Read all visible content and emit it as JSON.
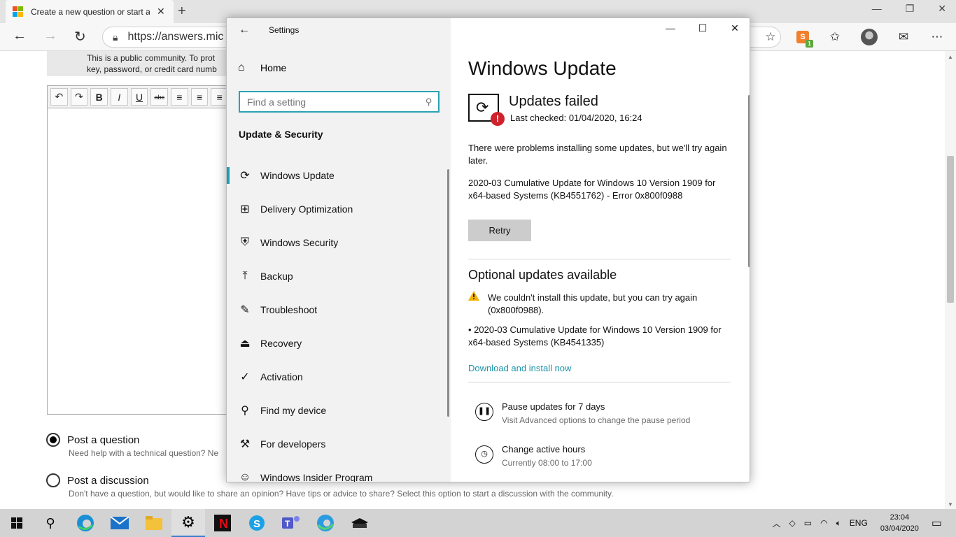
{
  "browser": {
    "tab_title": "Create a new question or start a",
    "tab_close": "✕",
    "new_tab": "+",
    "url": "https://answers.mic",
    "favicon_colors": [
      "#f25022",
      "#7fba00",
      "#00a4ef",
      "#ffb900"
    ],
    "ext_badge": "S"
  },
  "page": {
    "notice_line1": "This is a public community. To prot",
    "notice_line2": "key, password, or credit card numb",
    "toolbar": [
      "↶",
      "↷",
      "B",
      "I",
      "U",
      "abc",
      "≡",
      "≡",
      "≡"
    ],
    "post_question": {
      "label": "Post a question",
      "desc": "Need help with a technical question? Ne",
      "checked": true
    },
    "post_discussion": {
      "label": "Post a discussion",
      "desc": "Don't have a question, but would like to share an opinion? Have tips or advice to share? Select this option to start a discussion with the community.",
      "checked": false
    }
  },
  "settings": {
    "app_title": "Settings",
    "home": "Home",
    "search_placeholder": "Find a setting",
    "section": "Update & Security",
    "nav": [
      {
        "label": "Windows Update",
        "icon": "sync-icon",
        "glyph": "⟳"
      },
      {
        "label": "Delivery Optimization",
        "icon": "delivery-icon",
        "glyph": "⊞"
      },
      {
        "label": "Windows Security",
        "icon": "shield-icon",
        "glyph": "⛨"
      },
      {
        "label": "Backup",
        "icon": "backup-icon",
        "glyph": "⤒"
      },
      {
        "label": "Troubleshoot",
        "icon": "wrench-icon",
        "glyph": "✎"
      },
      {
        "label": "Recovery",
        "icon": "recovery-icon",
        "glyph": "⏏"
      },
      {
        "label": "Activation",
        "icon": "check-circle-icon",
        "glyph": "✓"
      },
      {
        "label": "Find my device",
        "icon": "person-icon",
        "glyph": "⚲"
      },
      {
        "label": "For developers",
        "icon": "developer-icon",
        "glyph": "⚒"
      },
      {
        "label": "Windows Insider Program",
        "icon": "insider-icon",
        "glyph": "☺"
      }
    ],
    "main": {
      "title": "Windows Update",
      "status": "Updates failed",
      "last_checked": "Last checked: 01/04/2020, 16:24",
      "problem_text": "There were problems installing some updates, but we'll try again later.",
      "error_text": "2020-03 Cumulative Update for Windows 10 Version 1909 for x64-based Systems (KB4551762) - Error 0x800f0988",
      "retry": "Retry",
      "optional_heading": "Optional updates available",
      "warn_text": "We couldn't install this update, but you can try again (0x800f0988).",
      "optional_update": "• 2020-03 Cumulative Update for Windows 10 Version 1909 for x64-based Systems (KB4541335)",
      "download_link": "Download and install now",
      "pause_title": "Pause updates for 7 days",
      "pause_desc": "Visit Advanced options to change the pause period",
      "hours_title": "Change active hours",
      "hours_desc": "Currently 08:00 to 17:00"
    }
  },
  "taskbar": {
    "lang": "ENG",
    "time": "23:04",
    "date": "03/04/2020"
  }
}
